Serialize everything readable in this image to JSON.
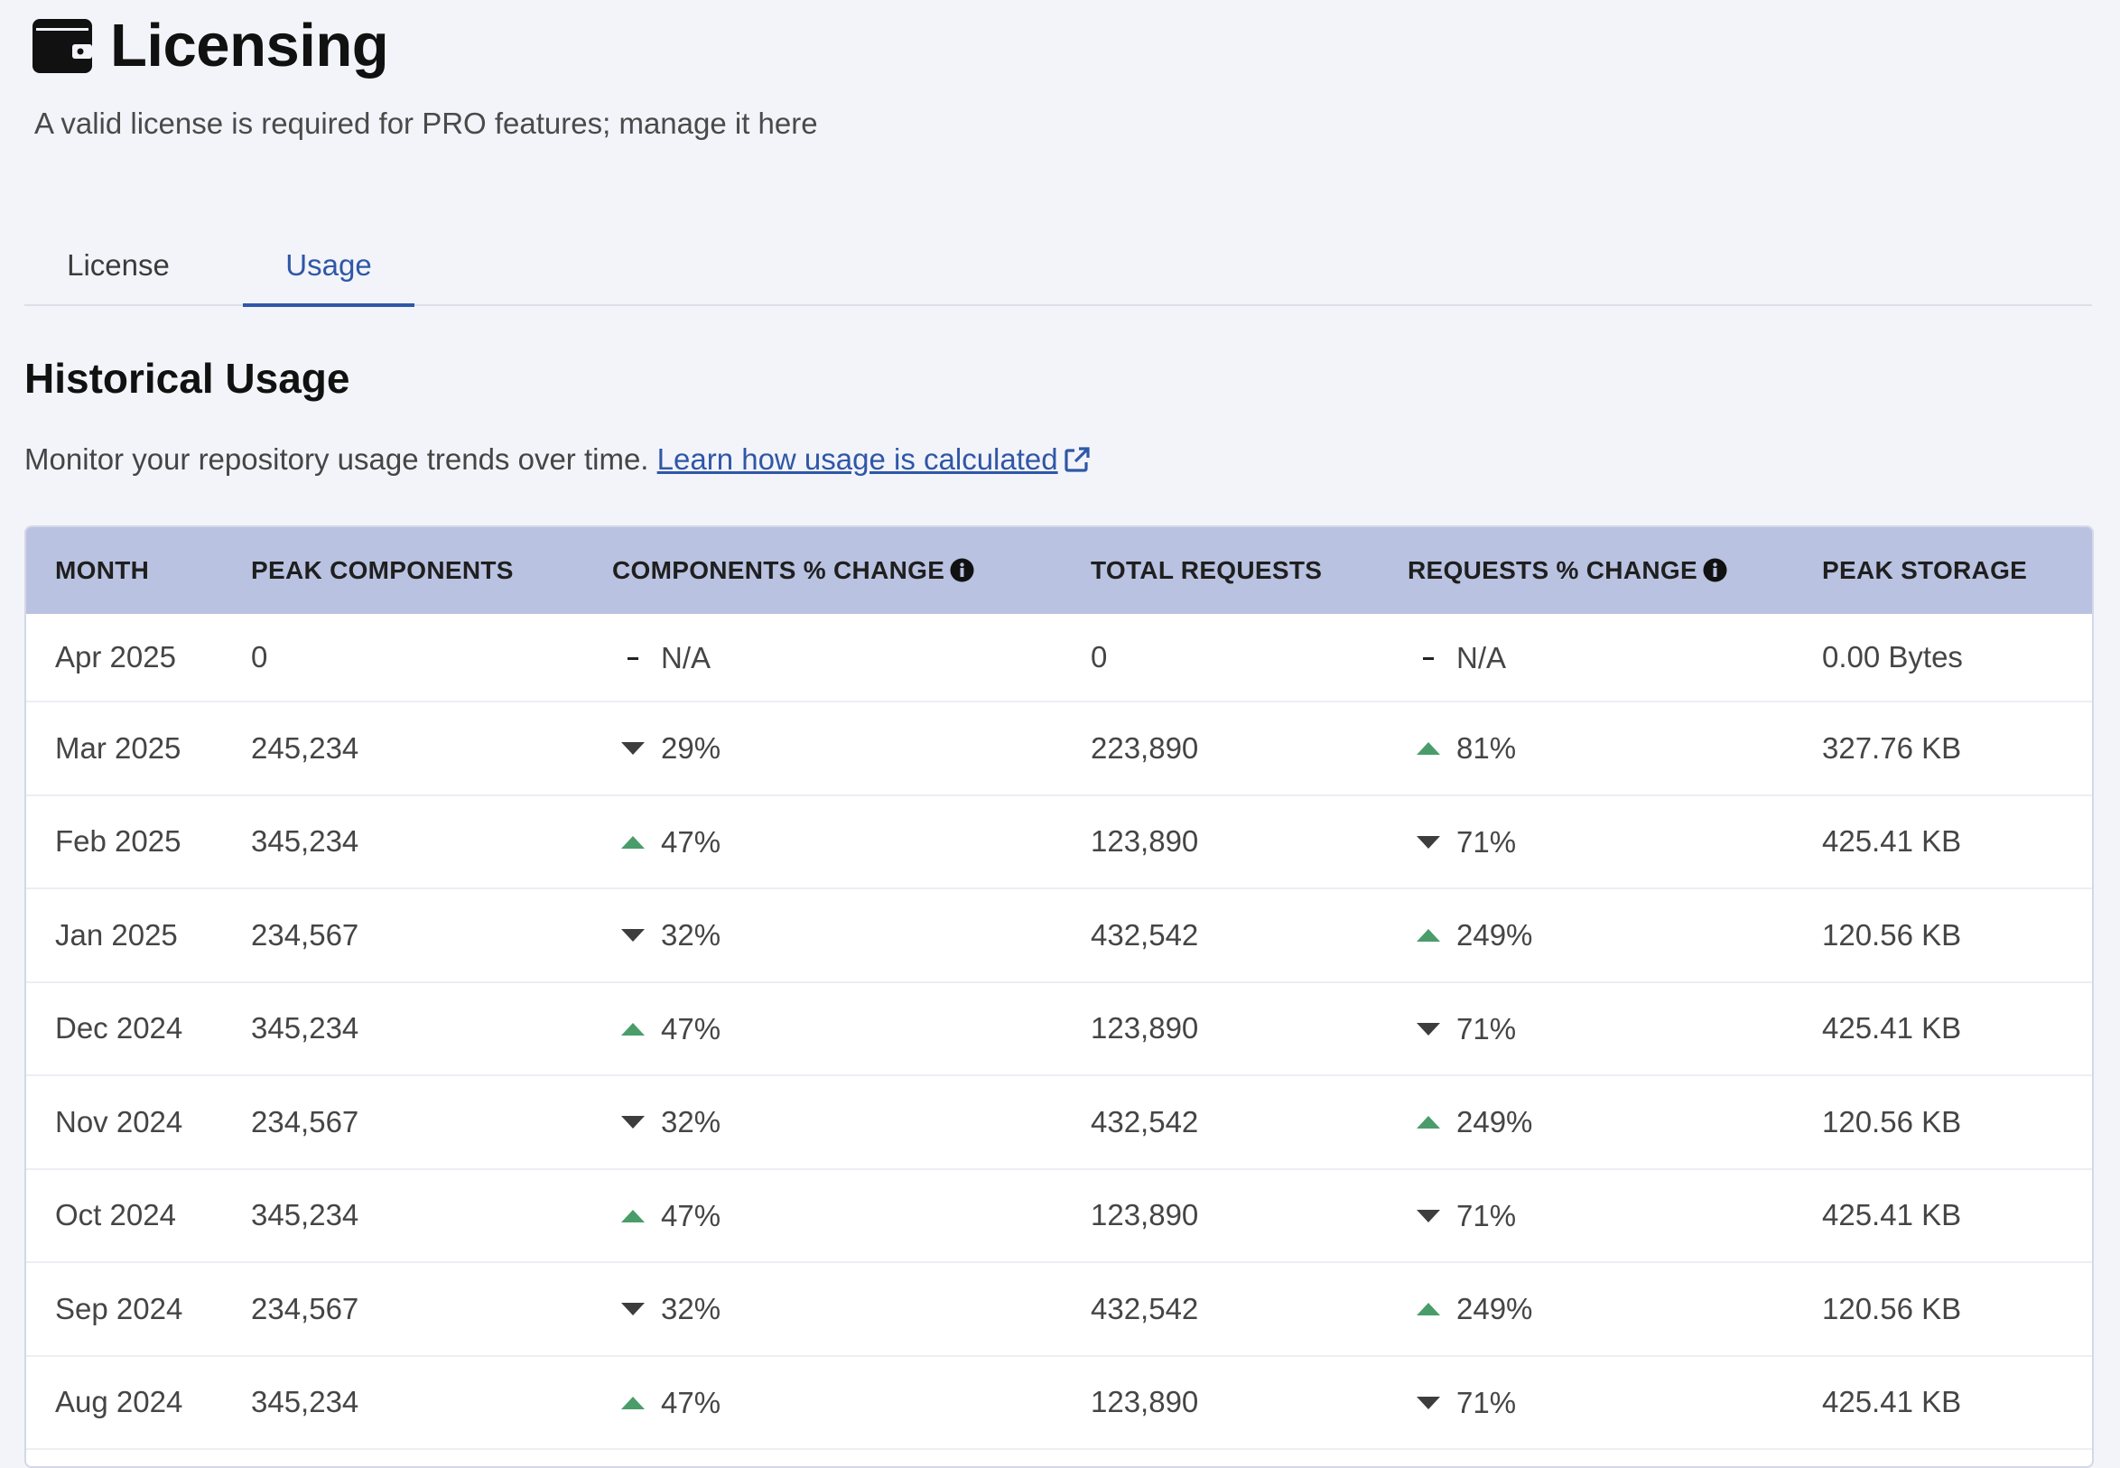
{
  "header": {
    "icon": "wallet-icon",
    "title": "Licensing",
    "subtitle": "A valid license is required for PRO features; manage it here"
  },
  "tabs": [
    {
      "label": "License",
      "active": false
    },
    {
      "label": "Usage",
      "active": true
    }
  ],
  "section": {
    "title": "Historical Usage",
    "description": "Monitor your repository usage trends over time.",
    "link_label": "Learn how usage is calculated",
    "link_icon": "external-link-icon"
  },
  "colors": {
    "accent": "#2f57a8",
    "header_bg": "#b9c2e0",
    "trend_up": "#4a9d6b",
    "trend_down": "#3d3d3d"
  },
  "table": {
    "columns": [
      "MONTH",
      "PEAK COMPONENTS",
      "COMPONENTS % CHANGE",
      "TOTAL REQUESTS",
      "REQUESTS % CHANGE",
      "PEAK STORAGE"
    ],
    "rows": [
      {
        "month": "Apr 2025",
        "peak_components": "0",
        "comp_trend": "none",
        "comp_change": "N/A",
        "total_requests": "0",
        "req_trend": "none",
        "req_change": "N/A",
        "peak_storage": "0.00 Bytes"
      },
      {
        "month": "Mar 2025",
        "peak_components": "245,234",
        "comp_trend": "down",
        "comp_change": "29%",
        "total_requests": "223,890",
        "req_trend": "up",
        "req_change": "81%",
        "peak_storage": "327.76 KB"
      },
      {
        "month": "Feb 2025",
        "peak_components": "345,234",
        "comp_trend": "up",
        "comp_change": "47%",
        "total_requests": "123,890",
        "req_trend": "down",
        "req_change": "71%",
        "peak_storage": "425.41 KB"
      },
      {
        "month": "Jan 2025",
        "peak_components": "234,567",
        "comp_trend": "down",
        "comp_change": "32%",
        "total_requests": "432,542",
        "req_trend": "up",
        "req_change": "249%",
        "peak_storage": "120.56 KB"
      },
      {
        "month": "Dec 2024",
        "peak_components": "345,234",
        "comp_trend": "up",
        "comp_change": "47%",
        "total_requests": "123,890",
        "req_trend": "down",
        "req_change": "71%",
        "peak_storage": "425.41 KB"
      },
      {
        "month": "Nov 2024",
        "peak_components": "234,567",
        "comp_trend": "down",
        "comp_change": "32%",
        "total_requests": "432,542",
        "req_trend": "up",
        "req_change": "249%",
        "peak_storage": "120.56 KB"
      },
      {
        "month": "Oct 2024",
        "peak_components": "345,234",
        "comp_trend": "up",
        "comp_change": "47%",
        "total_requests": "123,890",
        "req_trend": "down",
        "req_change": "71%",
        "peak_storage": "425.41 KB"
      },
      {
        "month": "Sep 2024",
        "peak_components": "234,567",
        "comp_trend": "down",
        "comp_change": "32%",
        "total_requests": "432,542",
        "req_trend": "up",
        "req_change": "249%",
        "peak_storage": "120.56 KB"
      },
      {
        "month": "Aug 2024",
        "peak_components": "345,234",
        "comp_trend": "up",
        "comp_change": "47%",
        "total_requests": "123,890",
        "req_trend": "down",
        "req_change": "71%",
        "peak_storage": "425.41 KB"
      }
    ]
  }
}
